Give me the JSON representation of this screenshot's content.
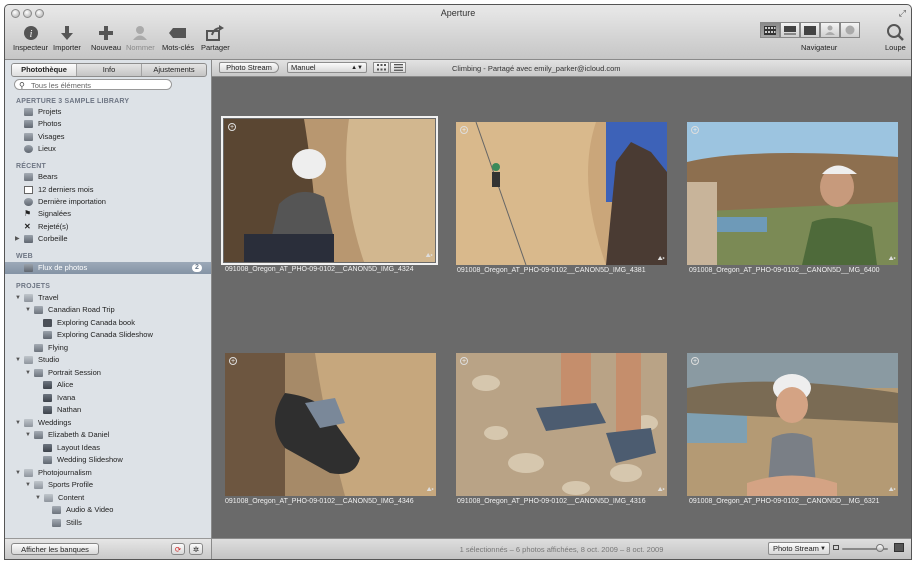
{
  "window": {
    "title": "Aperture"
  },
  "toolbar": {
    "items": [
      {
        "label": "Inspecteur",
        "icon": "info-icon"
      },
      {
        "label": "Importer",
        "icon": "import-arrow-icon"
      },
      {
        "label": "Nouveau",
        "icon": "plus-icon"
      },
      {
        "label": "Nommer",
        "icon": "person-icon"
      },
      {
        "label": "Mots-clés",
        "icon": "tag-icon"
      },
      {
        "label": "Partager",
        "icon": "share-icon"
      }
    ],
    "navigator_label": "Navigateur",
    "loupe_label": "Loupe"
  },
  "sidebar": {
    "tabs": [
      "Photothèque",
      "Info",
      "Ajustements"
    ],
    "search_placeholder": "Tous les éléments",
    "sections": {
      "library": "APERTURE 3 SAMPLE LIBRARY",
      "recent": "RÉCENT",
      "web": "WEB",
      "projects": "PROJETS"
    },
    "library_items": [
      "Projets",
      "Photos",
      "Visages",
      "Lieux"
    ],
    "recent_items": [
      "Bears",
      "12 derniers mois",
      "Dernière importation",
      "Signalées",
      "Rejeté(s)",
      "Corbeille"
    ],
    "web_items": [
      {
        "label": "Flux de photos",
        "badge": "2"
      }
    ],
    "project_items": [
      "Travel",
      "Canadian Road Trip",
      "Exploring Canada book",
      "Exploring Canada Slideshow",
      "Flying",
      "Studio",
      "Portrait Session",
      "Alice",
      "Ivana",
      "Nathan",
      "Weddings",
      "Elizabeth & Daniel",
      "Layout Ideas",
      "Wedding Slideshow",
      "Photojournalism",
      "Sports Profile",
      "Content",
      "Audio & Video",
      "Stills"
    ],
    "show_vaults_button": "Afficher les banques"
  },
  "browser": {
    "photo_stream_button": "Photo Stream",
    "sort_select": "Manuel",
    "breadcrumb": "Climbing - Partagé avec emily_parker@icloud.com",
    "photos": [
      {
        "caption": "091008_Oregon_AT_PHO-09-0102__CANON5D_IMG_4324"
      },
      {
        "caption": "091008_Oregon_AT_PHO-09-0102__CANON5D_IMG_4381"
      },
      {
        "caption": "091008_Oregon_AT_PHO-09-0102__CANON5D__MG_6400"
      },
      {
        "caption": "091008_Oregon_AT_PHO-09-0102__CANON5D_IMG_4346"
      },
      {
        "caption": "091008_Oregon_AT_PHO-09-0102__CANON5D_IMG_4316"
      },
      {
        "caption": "091008_Oregon_AT_PHO-09-0102__CANON5D__MG_6321"
      }
    ],
    "status": "1 sélectionnés – 6 photos affichées, 8 oct. 2009 – 8 oct. 2009",
    "photo_stream_menu": "Photo Stream"
  },
  "colors": {
    "sidebar_bg": "#dde2e7",
    "browser_bg": "#6a6a6a",
    "selection": "#8d9bad"
  }
}
